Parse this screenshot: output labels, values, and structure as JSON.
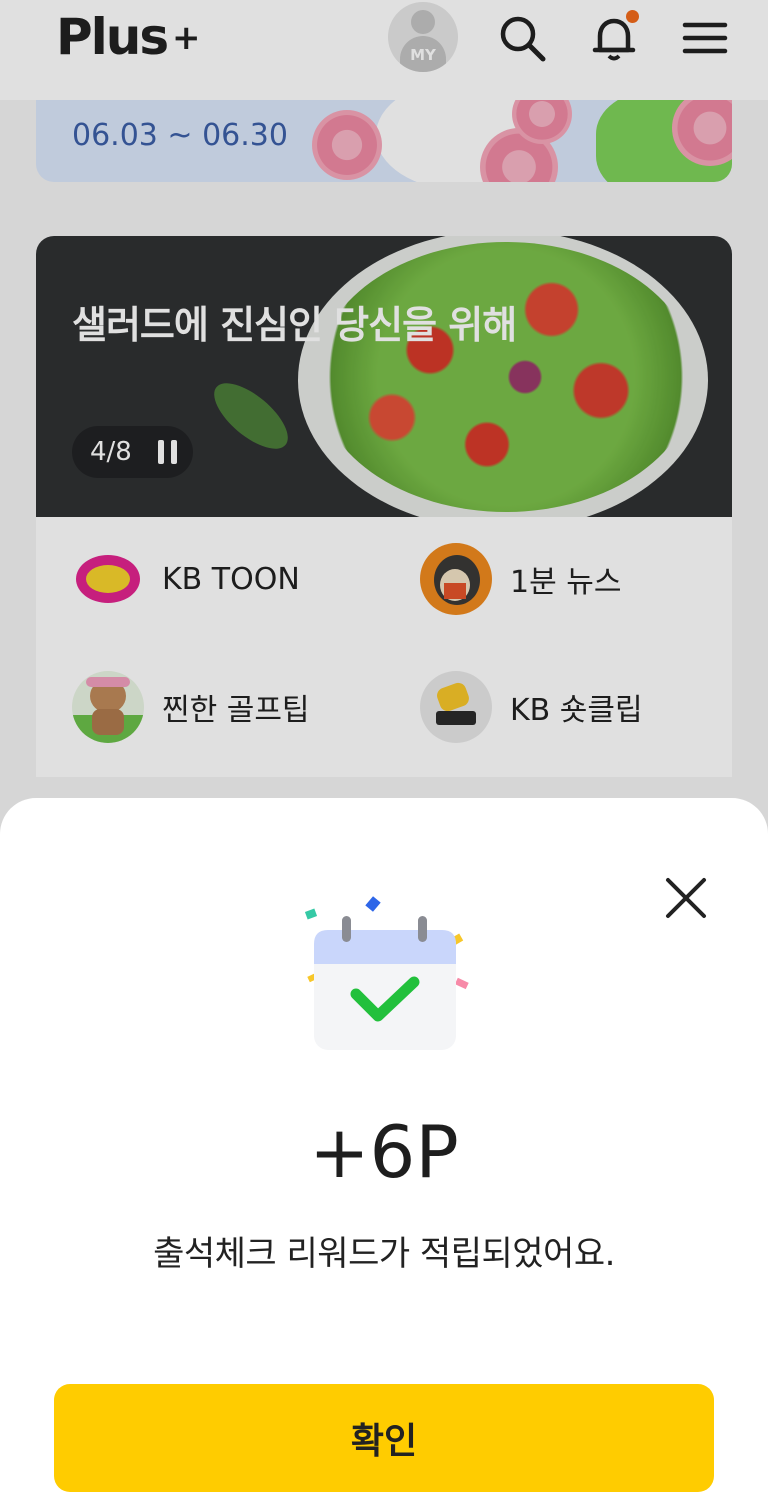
{
  "header": {
    "logo": "Plus",
    "logo_plus": "+",
    "avatar_label": "MY",
    "icons": [
      "search-icon",
      "bell-icon",
      "menu-icon"
    ],
    "notification_dot_color": "#f26a1b"
  },
  "banner": {
    "date_range": "06.03 ~ 06.30"
  },
  "slider": {
    "title": "샐러드에 진심인 당신을 위해",
    "counter": "4/8"
  },
  "services": [
    {
      "label": "KB TOON",
      "icon": "kb-toon-icon"
    },
    {
      "label": "1분 뉴스",
      "icon": "hedgehog-news-icon"
    },
    {
      "label": "찐한 골프팁",
      "icon": "golf-bear-icon"
    },
    {
      "label": "KB 숏클립",
      "icon": "shortclip-icon"
    }
  ],
  "sheet": {
    "points": "+6P",
    "message": "출석체크 리워드가 적립되었어요.",
    "confirm_label": "확인",
    "accent_color": "#ffcc00",
    "check_color": "#22c03c"
  }
}
